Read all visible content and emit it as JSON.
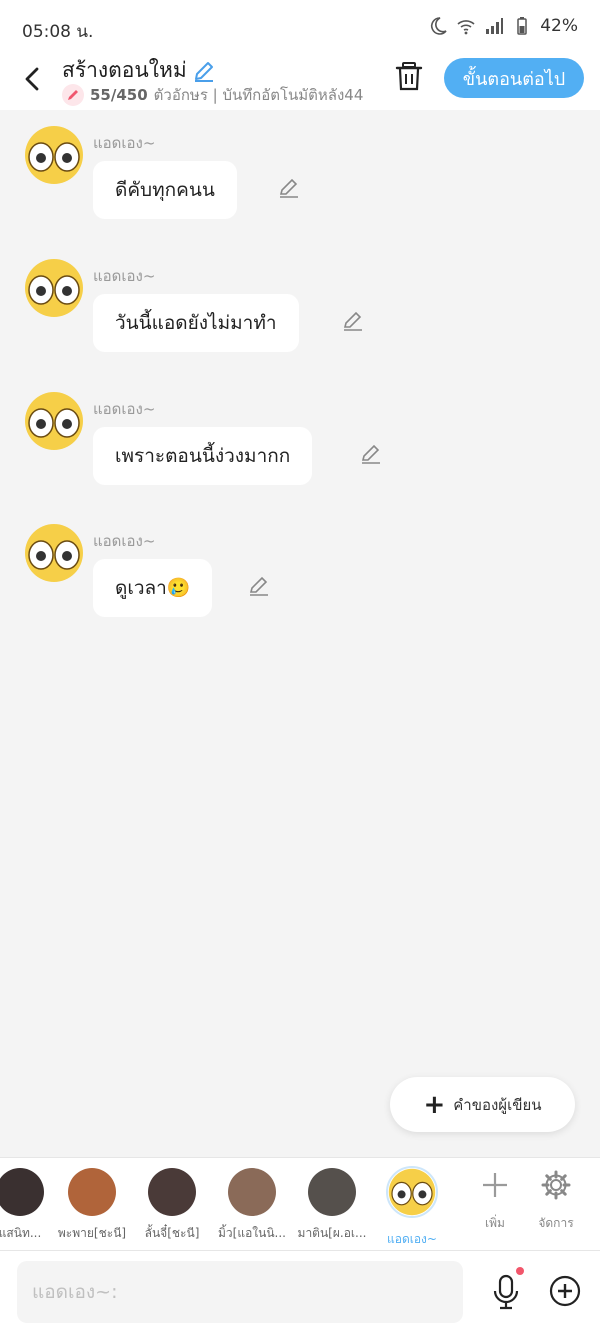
{
  "status": {
    "time": "05:08 น.",
    "battery": "42%"
  },
  "header": {
    "title": "สร้างตอนใหม่",
    "char_count": "55/450",
    "meta_rest": "ตัวอักษร | บันทึกอัตโนมัติหลัง44",
    "next_label": "ขั้นตอนต่อไป"
  },
  "messages": [
    {
      "sender": "แอดเอง~",
      "text": "ดีคับทุกคนน"
    },
    {
      "sender": "แอดเอง~",
      "text": "วันนี้แอดยังไม่มาทำ"
    },
    {
      "sender": "แอดเอง~",
      "text": "เพราะตอนนี้ง่วงมากก"
    },
    {
      "sender": "แอดเอง~",
      "text": "ดูเวลา🥲"
    }
  ],
  "author_note": {
    "label": "คำของผู้เขียน"
  },
  "characters": [
    {
      "name": "แสนิท...",
      "color": "#3a3030"
    },
    {
      "name": "พะพาย[ชะนี]",
      "color": "#b0643a"
    },
    {
      "name": "ลั้นจี๋[ชะนี]",
      "color": "#4a3a38"
    },
    {
      "name": "มิ้ว[แอในนิ...",
      "color": "#8a6a58"
    },
    {
      "name": "มาติน[ผ.อเ...",
      "color": "#55504c"
    },
    {
      "name": "แอดเอง~",
      "color": "#f6d04d"
    }
  ],
  "tools": {
    "add_label": "เพิ่ม",
    "manage_label": "จัดการ"
  },
  "input": {
    "placeholder": "แอดเอง~:"
  },
  "colors": {
    "accent": "#52aff3",
    "badge": "#f2566b"
  }
}
